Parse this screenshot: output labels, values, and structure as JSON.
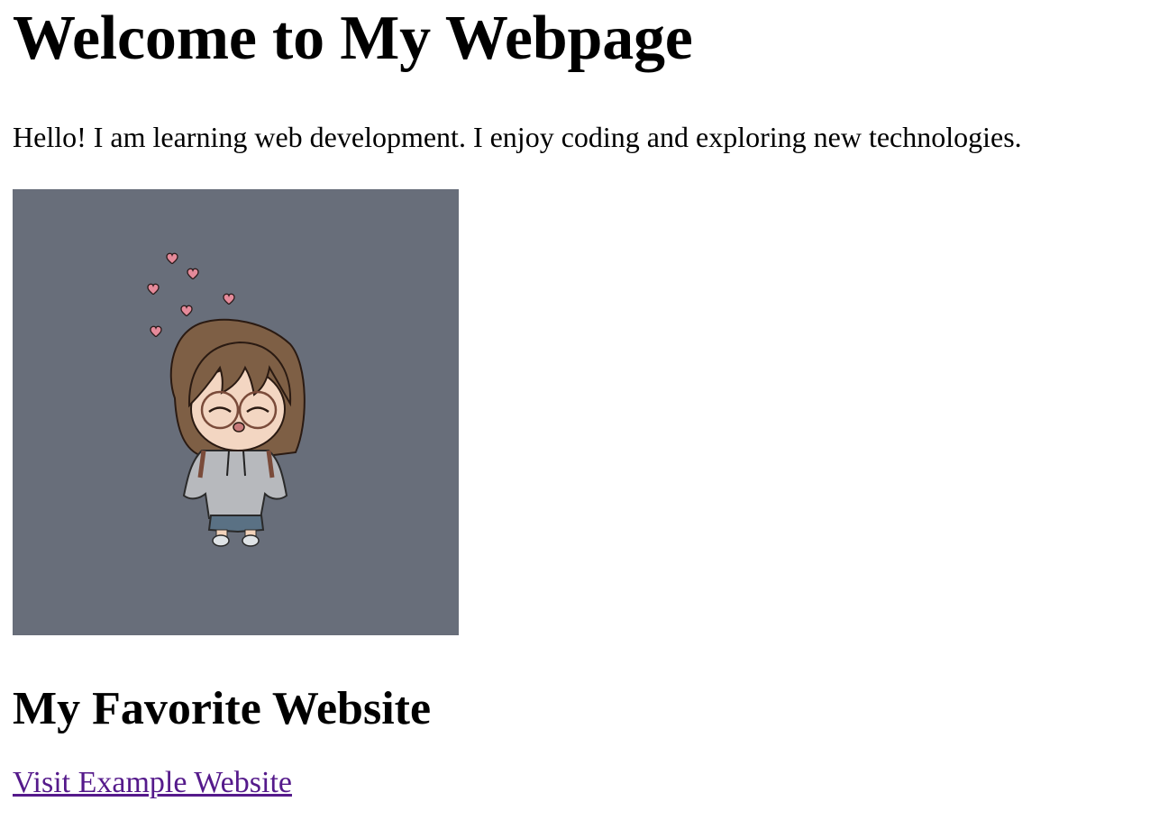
{
  "page": {
    "title": "Welcome to My Webpage",
    "intro": "Hello! I am learning web development. I enjoy coding and exploring new technologies.",
    "image": {
      "subject": "chibi-girl-illustration",
      "background_color": "#686e7a"
    },
    "section_title": "My Favorite Website",
    "link_label": "Visit Example Website",
    "link_color": "#551a8b"
  }
}
